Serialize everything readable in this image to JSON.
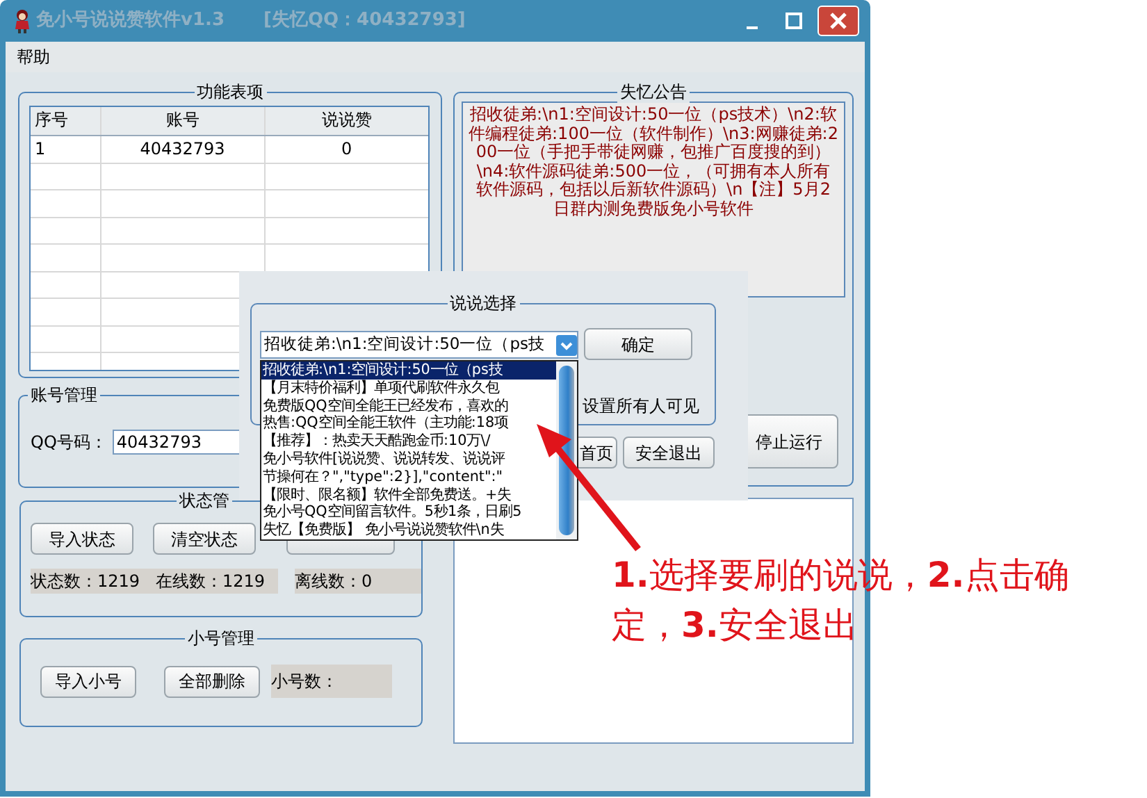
{
  "window": {
    "title": "免小号说说赞软件v1.3",
    "subtitle": "[失忆QQ：40432793]"
  },
  "menu": [
    "帮助"
  ],
  "function_table": {
    "title": "功能表项",
    "columns": [
      "序号",
      "账号",
      "说说赞"
    ],
    "rows": [
      [
        "1",
        "40432793",
        "0"
      ]
    ]
  },
  "notice": {
    "title": "失忆公告",
    "text": "招收徒弟:\\n1:空间设计:50一位（ps技术）\\n2:软件编程徒弟:100一位（软件制作）\\n3:网赚徒弟:200一位（手把手带徒网赚，包推广百度搜的到）\\n4:软件源码徒弟:500一位，（可拥有本人所有软件源码，包括以后新软件源码）\\n【注】5月2日群内测免费版免小号软件"
  },
  "account": {
    "title": "账号管理",
    "qq_label": "QQ号码：",
    "qq_value": "40432793"
  },
  "status": {
    "title": "状态管",
    "buttons": [
      "导入状态",
      "清空状态"
    ],
    "count": "状态数：1219",
    "online": "在线数：1219",
    "offline": "离线数：0"
  },
  "accounts": {
    "title": "小号管理",
    "buttons": [
      "导入小号",
      "全部删除"
    ],
    "count": "小号数："
  },
  "stop_button": "停止运行",
  "dialog": {
    "title": "说说选择",
    "select_value": "招收徒弟:\\n1:空间设计:50一位（ps技",
    "confirm": "确定",
    "visible_label": "设置所有人可见",
    "buttons": [
      "首页",
      "安全退出"
    ],
    "options": [
      {
        "text": "招收徒弟:\\n1:空间设计:50一位（ps技",
        "selected": true
      },
      {
        "text": "【月末特价福利】单项代刷软件永久包",
        "selected": false
      },
      {
        "text": "免费版QQ空间全能王已经发布，喜欢的",
        "selected": false
      },
      {
        "text": "热售:QQ空间全能王软件（主功能:18项",
        "selected": false
      },
      {
        "text": "【推荐】：热卖天天酷跑金币:10万\\/",
        "selected": false
      },
      {
        "text": "免小号软件[说说赞、说说转发、说说评",
        "selected": false
      },
      {
        "text": "节操何在？\",\"type\":2}],\"content\":\"",
        "selected": false
      },
      {
        "text": "【限时、限名额】软件全部免费送。+失",
        "selected": false
      },
      {
        "text": "免小号QQ空间留言软件。5秒1条，日刷5",
        "selected": false
      },
      {
        "text": "失忆【免费版】 免小号说说赞软件\\n失",
        "selected": false
      }
    ]
  },
  "annotation": "**1.**选择要刷的说说，**2.**点击确定，**3.**安全退出"
}
